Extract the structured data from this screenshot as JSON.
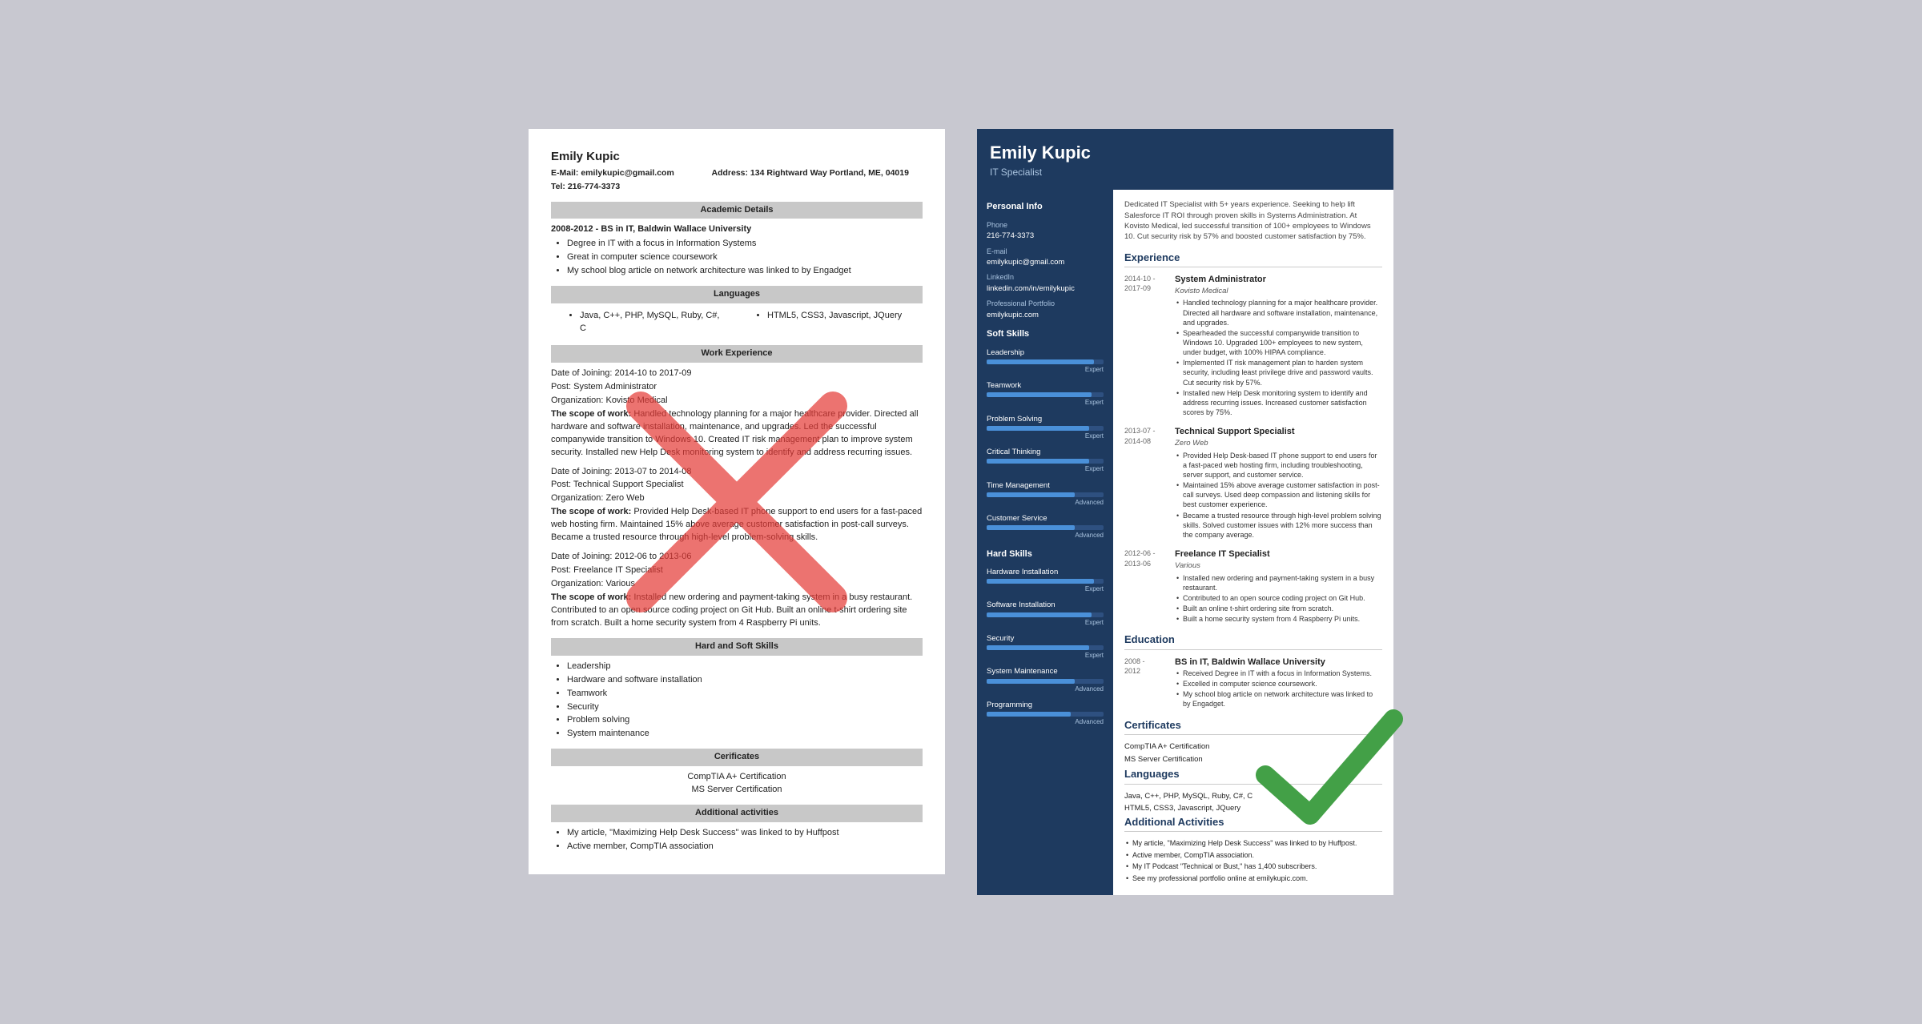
{
  "left_resume": {
    "name": "Emily Kupic",
    "email_label": "E-Mail:",
    "email": "emilykupic@gmail.com",
    "address_label": "Address:",
    "address": "134 Rightward Way Portland, ME, 04019",
    "tel_label": "Tel:",
    "tel": "216-774-3373",
    "sections": {
      "academic": {
        "title": "Academic Details",
        "degree": "2008-2012 - BS in IT, Baldwin Wallace University",
        "bullets": [
          "Degree in IT with a focus in Information Systems",
          "Great in computer science coursework",
          "My school blog article on network architecture was linked to by Engadget"
        ]
      },
      "languages": {
        "title": "Languages",
        "col1": "Java, C++, PHP, MySQL, Ruby, C#,\nC",
        "col2": "HTML5, CSS3, Javascript, JQuery"
      },
      "work": {
        "title": "Work Experience",
        "entries": [
          {
            "date": "Date of Joining: 2014-10 to 2017-09",
            "post": "Post: System Administrator",
            "org": "Organization: Kovisto Medical",
            "scope_label": "The scope of work:",
            "scope": "Handled technology planning for a major healthcare provider. Directed all hardware and software installation, maintenance, and upgrades. Led the successful companywide transition to Windows 10. Created IT risk management plan to improve system security. Installed new Help Desk monitoring system to identify and address recurring issues."
          },
          {
            "date": "Date of Joining: 2013-07 to 2014-08",
            "post": "Post: Technical Support Specialist",
            "org": "Organization: Zero Web",
            "scope_label": "The scope of work:",
            "scope": "Provided Help Desk-based IT phone support to end users for a fast-paced web hosting firm. Maintained 15% above average customer satisfaction in post-call surveys. Became a trusted resource through high-level problem-solving skills."
          },
          {
            "date": "Date of Joining: 2012-06 to 2013-06",
            "post": "Post: Freelance IT Specialist",
            "org": "Organization: Various",
            "scope_label": "The scope of work:",
            "scope": "Installed new ordering and payment-taking system in a busy restaurant. Contributed to an open source coding project on Git Hub. Built an online t-shirt ordering site from scratch. Built a home security system from 4 Raspberry Pi units."
          }
        ]
      },
      "skills": {
        "title": "Hard and Soft Skills",
        "bullets": [
          "Leadership",
          "Hardware and software installation",
          "Teamwork",
          "Security",
          "Problem solving",
          "System maintenance"
        ]
      },
      "certs": {
        "title": "Cerificates",
        "items": [
          "CompTIA A+ Certification",
          "MS Server Certification"
        ]
      },
      "activities": {
        "title": "Additional activities",
        "bullets": [
          "My article, \"Maximizing Help Desk Success\" was linked to by Huffpost",
          "Active member, CompTIA association"
        ]
      }
    }
  },
  "right_resume": {
    "name": "Emily Kupic",
    "title": "IT Specialist",
    "summary": "Dedicated IT Specialist with 5+ years experience. Seeking to help lift Salesforce IT ROI through proven skills in Systems Administration. At Kovisto Medical, led successful transition of 100+ employees to Windows 10. Cut security risk by 57% and boosted customer satisfaction by 75%.",
    "sidebar": {
      "personal_info_title": "Personal Info",
      "phone_label": "Phone",
      "phone": "216-774-3373",
      "email_label": "E-mail",
      "email": "emilykupic@gmail.com",
      "linkedin_label": "LinkedIn",
      "linkedin": "linkedin.com/in/emilykupic",
      "portfolio_label": "Professional Portfolio",
      "portfolio": "emilykupic.com",
      "soft_skills_title": "Soft Skills",
      "soft_skills": [
        {
          "name": "Leadership",
          "level": "Expert",
          "pct": 92
        },
        {
          "name": "Teamwork",
          "level": "Expert",
          "pct": 90
        },
        {
          "name": "Problem Solving",
          "level": "Expert",
          "pct": 88
        },
        {
          "name": "Critical Thinking",
          "level": "Expert",
          "pct": 88
        },
        {
          "name": "Time Management",
          "level": "Advanced",
          "pct": 75
        },
        {
          "name": "Customer Service",
          "level": "Advanced",
          "pct": 75
        }
      ],
      "hard_skills_title": "Hard Skills",
      "hard_skills": [
        {
          "name": "Hardware Installation",
          "level": "Expert",
          "pct": 92
        },
        {
          "name": "Software Installation",
          "level": "Expert",
          "pct": 90
        },
        {
          "name": "Security",
          "level": "Expert",
          "pct": 88
        },
        {
          "name": "System Maintenance",
          "level": "Advanced",
          "pct": 75
        },
        {
          "name": "Programming",
          "level": "Advanced",
          "pct": 72
        }
      ]
    },
    "experience_title": "Experience",
    "experience": [
      {
        "dates": "2014-10 -\n2017-09",
        "job_title": "System Administrator",
        "company": "Kovisto Medical",
        "bullets": [
          "Handled technology planning for a major healthcare provider. Directed all hardware and software installation, maintenance, and upgrades.",
          "Spearheaded the successful companywide transition to Windows 10. Upgraded 100+ employees to new system, under budget, with 100% HIPAA compliance.",
          "Implemented IT risk management plan to harden system security, including least privilege drive and password vaults. Cut security risk by 57%.",
          "Installed new Help Desk monitoring system to identify and address recurring issues. Increased customer satisfaction scores by 75%."
        ]
      },
      {
        "dates": "2013-07 -\n2014-08",
        "job_title": "Technical Support Specialist",
        "company": "Zero Web",
        "bullets": [
          "Provided Help Desk-based IT phone support to end users for a fast-paced web hosting firm, including troubleshooting, server support, and customer service.",
          "Maintained 15% above average customer satisfaction in post-call surveys. Used deep compassion and listening skills for best customer experience.",
          "Became a trusted resource through high-level problem solving skills. Solved customer issues with 12% more success than the company average."
        ]
      },
      {
        "dates": "2012-06 -\n2013-06",
        "job_title": "Freelance IT Specialist",
        "company": "Various",
        "bullets": [
          "Installed new ordering and payment-taking system in a busy restaurant.",
          "Contributed to an open source coding project on Git Hub.",
          "Built an online t-shirt ordering site from scratch.",
          "Built a home security system from 4 Raspberry Pi units."
        ]
      }
    ],
    "education_title": "Education",
    "education": [
      {
        "dates": "2008 -\n2012",
        "degree": "BS in IT, Baldwin Wallace University",
        "bullets": [
          "Received Degree in IT with a focus in Information Systems.",
          "Excelled in computer science coursework.",
          "My school blog article on network architecture was linked to by Engadget."
        ]
      }
    ],
    "certs_title": "Certificates",
    "certs": [
      "CompTIA A+ Certification",
      "MS Server Certification"
    ],
    "languages_title": "Languages",
    "languages": [
      "Java, C++, PHP, MySQL, Ruby, C#, C",
      "HTML5, CSS3, Javascript, JQuery"
    ],
    "activities_title": "Additional Activities",
    "activities": [
      "My article, \"Maximizing Help Desk Success\" was linked to by Huffpost.",
      "Active member, CompTIA association.",
      "My IT Podcast \"Technical or Bust,\" has 1,400 subscribers.",
      "See my professional portfolio online at emilykupic.com."
    ]
  }
}
